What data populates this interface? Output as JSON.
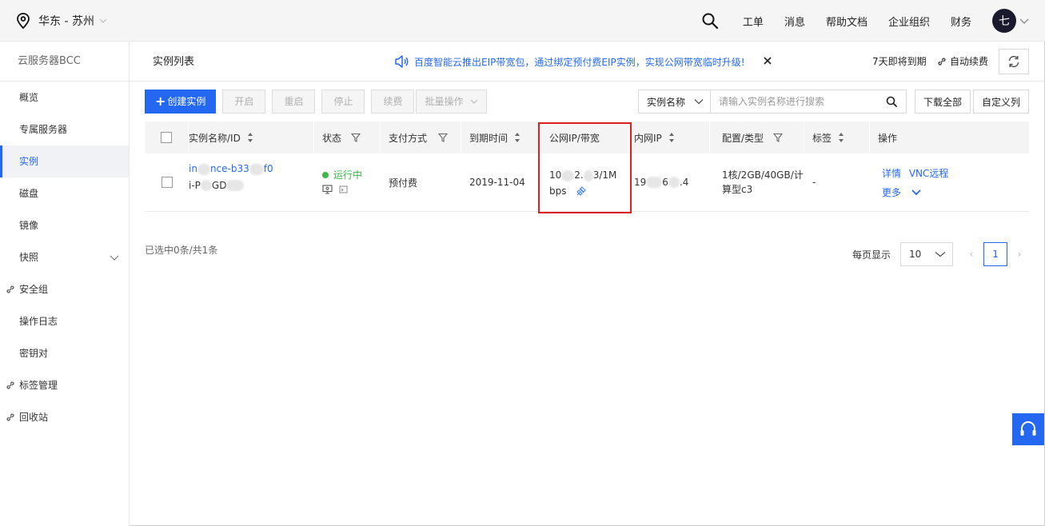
{
  "region": {
    "label": "华东 - 苏州"
  },
  "topnav": {
    "items": [
      "工单",
      "消息",
      "帮助文档",
      "企业组织",
      "财务"
    ],
    "avatar_char": "七"
  },
  "sidebar": {
    "title": "云服务器BCC",
    "items": [
      {
        "label": "概览"
      },
      {
        "label": "专属服务器"
      },
      {
        "label": "实例"
      },
      {
        "label": "磁盘"
      },
      {
        "label": "镜像"
      },
      {
        "label": "快照"
      },
      {
        "label": "安全组"
      },
      {
        "label": "操作日志"
      },
      {
        "label": "密钥对"
      },
      {
        "label": "标签管理"
      },
      {
        "label": "回收站"
      }
    ]
  },
  "header": {
    "page_title": "实例列表",
    "notice": "百度智能云推出EIP带宽包，通过绑定预付费EIP实例，实现公网带宽临时升级!",
    "expire_label": "7天即将到期",
    "auto_renew_label": "自动续费"
  },
  "toolbar": {
    "create_label": "创建实例",
    "start_label": "开启",
    "restart_label": "重启",
    "stop_label": "停止",
    "renew_label": "续费",
    "batch_label": "批量操作",
    "search_field": "实例名称",
    "search_placeholder": "请输入实例名称进行搜索",
    "download_label": "下载全部",
    "custom_cols_label": "自定义列"
  },
  "table": {
    "headers": {
      "name": "实例名称/ID",
      "status": "状态",
      "pay": "支付方式",
      "expire": "到期时间",
      "public_ip": "公网IP/带宽",
      "private_ip": "内网IP",
      "config": "配置/类型",
      "tags": "标签",
      "ops": "操作"
    },
    "row": {
      "name_a": "in",
      "name_b": "nce-b33",
      "name_c": "f0",
      "id_a": "i-P",
      "id_b": "GD",
      "status": "运行中",
      "pay": "预付费",
      "expire": "2019-11-04",
      "public_ip_a": "10",
      "public_ip_b": "2.",
      "public_ip_c": "3/1M",
      "bandwidth_unit": "bps",
      "private_ip_a": "19",
      "private_ip_b": "6",
      "private_ip_c": ".4",
      "config_line1": "1核/2GB/40GB/计",
      "config_line2": "算型c3",
      "tags": "-",
      "op_detail": "详情",
      "op_vnc": "VNC远程",
      "op_more": "更多"
    }
  },
  "footer": {
    "count_label": "已选中0条/共1条",
    "per_page_label": "每页显示",
    "page_size": "10",
    "current_page": "1"
  },
  "colors": {
    "accent": "#2468f2",
    "running": "#3bb84a",
    "highlight": "#e02020"
  }
}
